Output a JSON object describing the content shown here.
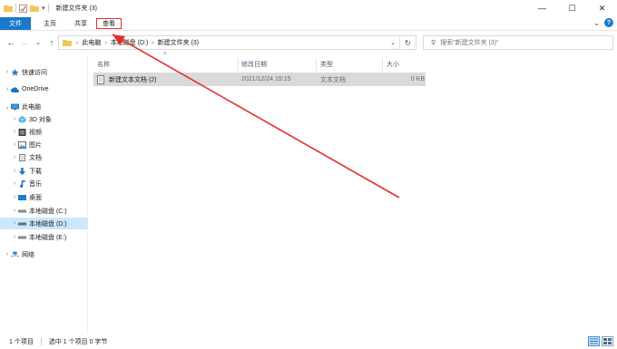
{
  "window": {
    "title": "新建文件夹 (3)",
    "controls": {
      "minimize": "—",
      "maximize": "☐",
      "close": "✕"
    },
    "quick_access_dropdown": "▾"
  },
  "ribbon": {
    "tabs": [
      {
        "label": "文件"
      },
      {
        "label": "主页"
      },
      {
        "label": "共享"
      },
      {
        "label": "查看"
      }
    ],
    "expand_glyph": "⌄",
    "help_glyph": "?"
  },
  "nav_buttons": {
    "back": "←",
    "forward": "→",
    "recent": "⌄",
    "up": "↑"
  },
  "address": {
    "crumbs": [
      "此电脑",
      "本地磁盘 (D:)",
      "新建文件夹 (3)"
    ],
    "separator": "›",
    "dropdown": "⌄",
    "refresh": "↻"
  },
  "search": {
    "placeholder": "搜索\"新建文件夹 (3)\"",
    "glyph": "⚲"
  },
  "navpane": {
    "items": [
      {
        "label": "快速访问",
        "chevron": "›",
        "icon": "star-icon"
      },
      {
        "label": "OneDrive",
        "chevron": "›",
        "icon": "cloud-icon"
      },
      {
        "label": "此电脑",
        "chevron": "⌄",
        "icon": "computer-icon"
      },
      {
        "label": "3D 对象",
        "chevron": "›",
        "icon": "cube-icon"
      },
      {
        "label": "视频",
        "chevron": "›",
        "icon": "video-icon"
      },
      {
        "label": "图片",
        "chevron": "›",
        "icon": "picture-icon"
      },
      {
        "label": "文档",
        "chevron": "›",
        "icon": "document-icon"
      },
      {
        "label": "下载",
        "chevron": "›",
        "icon": "download-icon"
      },
      {
        "label": "音乐",
        "chevron": "›",
        "icon": "music-icon"
      },
      {
        "label": "桌面",
        "chevron": "›",
        "icon": "desktop-icon"
      },
      {
        "label": "本地磁盘 (C:)",
        "chevron": "›",
        "icon": "drive-icon"
      },
      {
        "label": "本地磁盘 (D:)",
        "chevron": "›",
        "icon": "drive-icon",
        "selected": true
      },
      {
        "label": "本地磁盘 (E:)",
        "chevron": "›",
        "icon": "drive-icon"
      },
      {
        "label": "网络",
        "chevron": "›",
        "icon": "network-icon"
      }
    ]
  },
  "columns": {
    "name": "名称",
    "modified": "修改日期",
    "type": "类型",
    "size": "大小",
    "sort_glyph": "^"
  },
  "files": [
    {
      "name": "新建文本文档 (2)",
      "modified": "2021/12/24 15:15",
      "type": "文本文档",
      "size": "0 KB"
    }
  ],
  "status": {
    "count": "1 个项目",
    "selection": "选中 1 个项目 0 字节"
  },
  "colors": {
    "accent": "#1979ca",
    "annotation_red": "#e03030",
    "selection": "#cce8ff",
    "row_highlight": "#d9d9d9"
  }
}
